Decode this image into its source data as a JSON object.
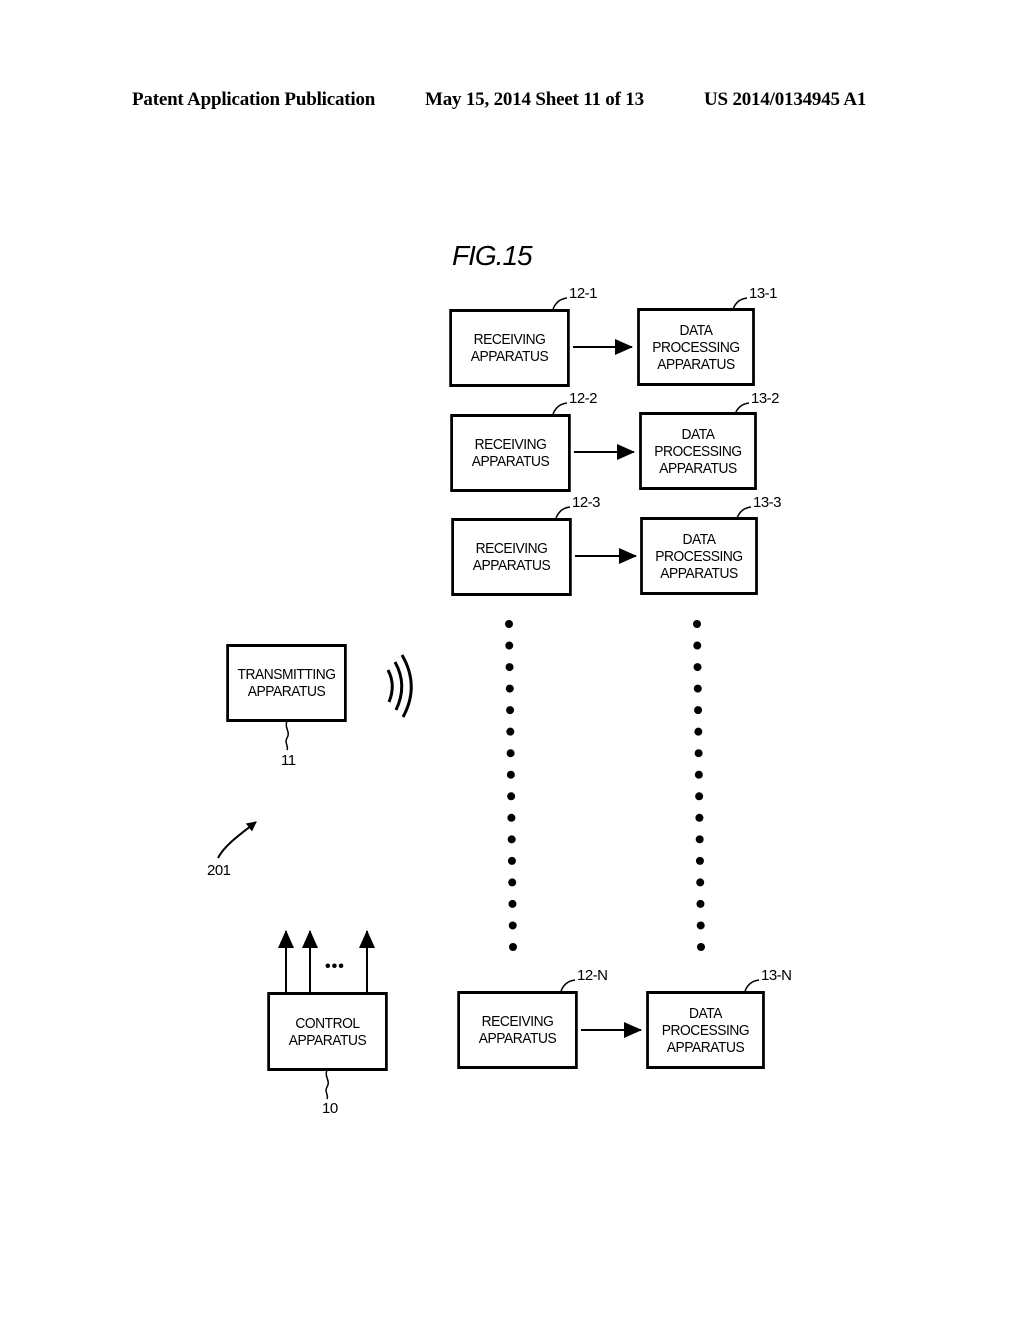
{
  "header": {
    "publication": "Patent Application Publication",
    "date_sheet": "May 15, 2014  Sheet 11 of 13",
    "patent_number": "US 2014/0134945 A1"
  },
  "figure": {
    "title": "FIG.15",
    "system_ref": "201",
    "transmitter": {
      "label": "TRANSMITTING\nAPPARATUS",
      "ref": "11"
    },
    "control": {
      "label": "CONTROL\nAPPARATUS",
      "ref": "10",
      "ellipsis": "•••"
    },
    "receivers": [
      {
        "label": "RECEIVING\nAPPARATUS",
        "ref": "12-1"
      },
      {
        "label": "RECEIVING\nAPPARATUS",
        "ref": "12-2"
      },
      {
        "label": "RECEIVING\nAPPARATUS",
        "ref": "12-3"
      },
      {
        "label": "RECEIVING\nAPPARATUS",
        "ref": "12-N"
      }
    ],
    "processors": [
      {
        "label": "DATA\nPROCESSING\nAPPARATUS",
        "ref": "13-1"
      },
      {
        "label": "DATA\nPROCESSING\nAPPARATUS",
        "ref": "13-2"
      },
      {
        "label": "DATA\nPROCESSING\nAPPARATUS",
        "ref": "13-3"
      },
      {
        "label": "DATA\nPROCESSING\nAPPARATUS",
        "ref": "13-N"
      }
    ]
  }
}
